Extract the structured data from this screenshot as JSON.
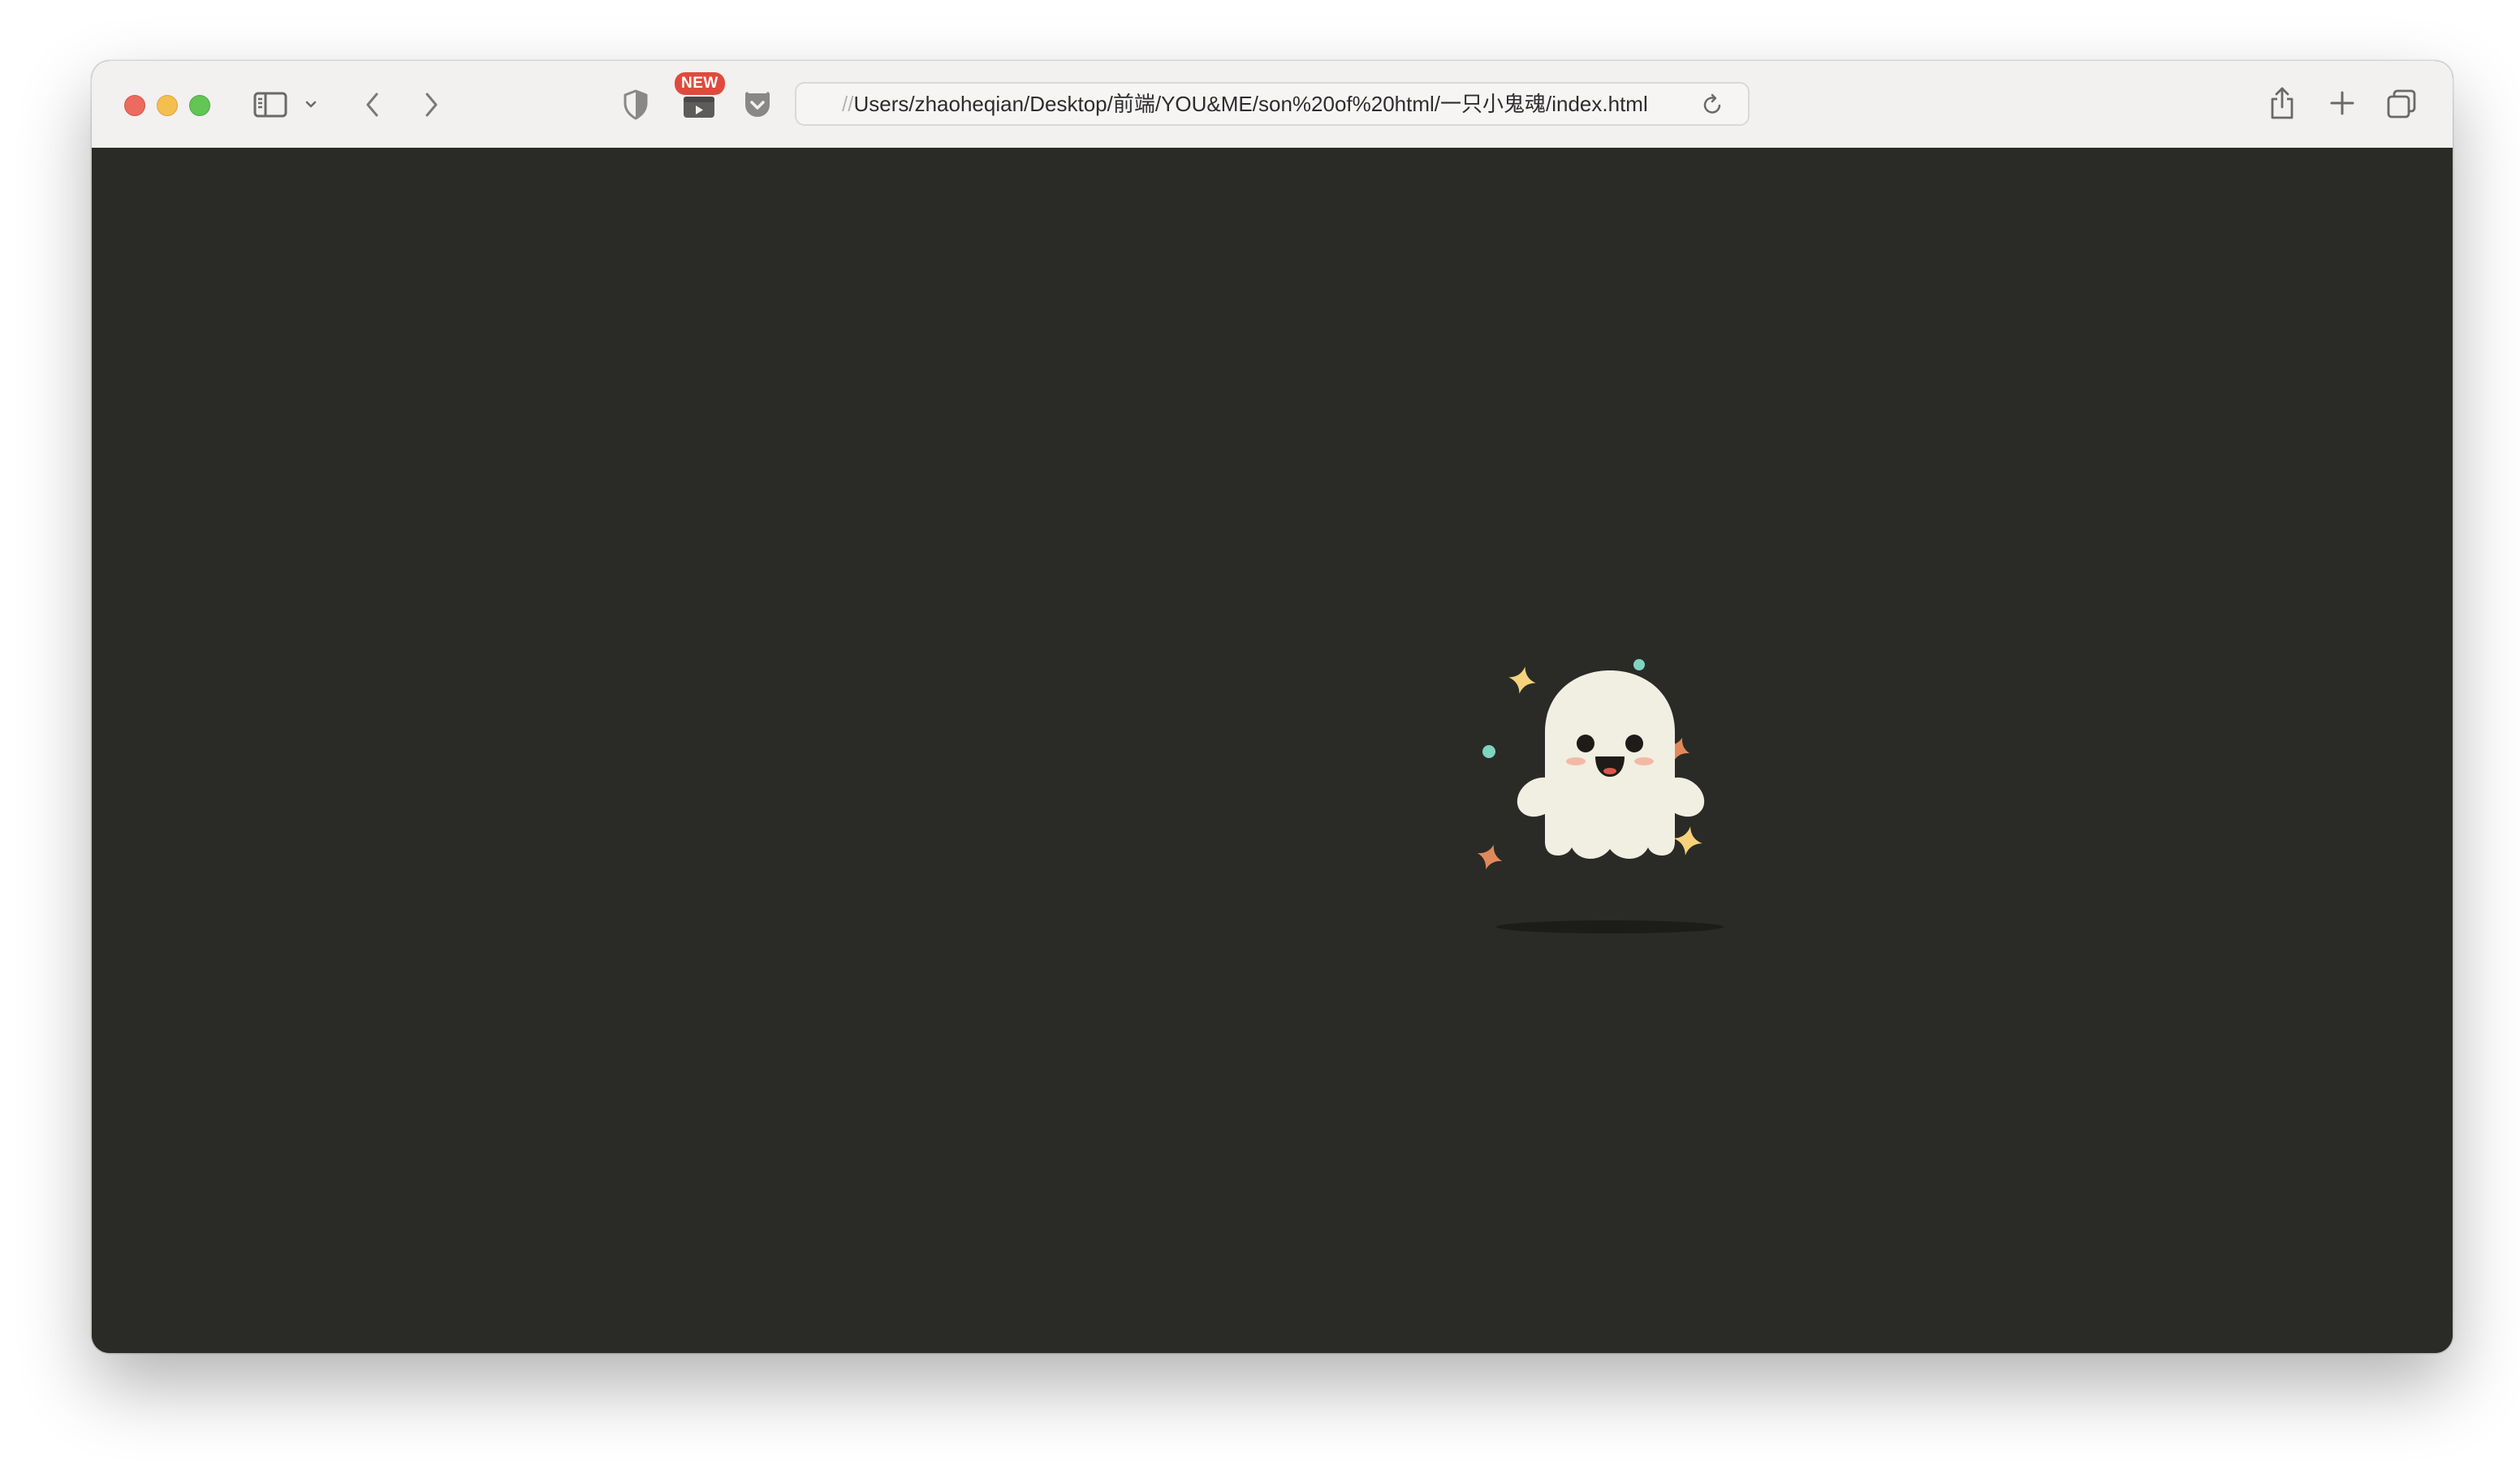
{
  "window": {
    "traffic_lights": [
      "close",
      "minimize",
      "zoom"
    ]
  },
  "toolbar": {
    "sidebar_icon": "sidebar-icon",
    "back_icon": "chevron-left-icon",
    "forward_icon": "chevron-right-icon",
    "privacy_icon": "shield-icon",
    "extension_badge": "NEW",
    "extension_icon": "video-player-icon",
    "extension2_icon": "pocket-icon",
    "url_prefix": "//",
    "url": "Users/zhaoheqian/Desktop/前端/YOU&ME/son%20of%20html/一只小鬼魂/index.html",
    "reload_icon": "reload-icon",
    "share_icon": "share-icon",
    "new_tab_icon": "plus-icon",
    "tab_overview_icon": "tabs-overview-icon"
  },
  "page": {
    "background": "#2a2b27",
    "ghost": {
      "body_color": "#f1efe1",
      "eye_color": "#1e1b18",
      "blush_color": "#f3b9a6",
      "shadow_color": "#1a1a17"
    },
    "sparkles": {
      "yellow": "#f6d37a",
      "orange": "#e08a5c",
      "teal": "#7fd4c1"
    }
  }
}
